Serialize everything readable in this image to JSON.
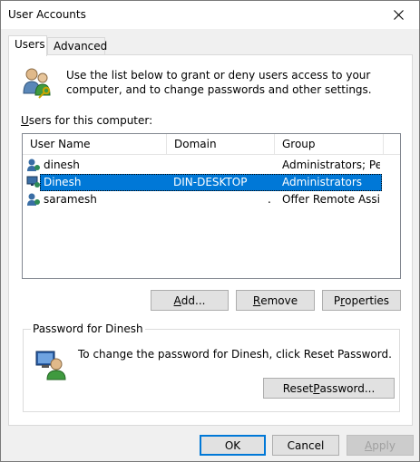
{
  "window": {
    "title": "User Accounts"
  },
  "icons": {
    "close": "close-icon",
    "users": "users-keys-icon",
    "user": "user-icon",
    "password": "password-user-icon"
  },
  "tabs": [
    {
      "label": "Users",
      "active": true
    },
    {
      "label": "Advanced",
      "active": false
    }
  ],
  "intro": {
    "text": "Use the list below to grant or deny users access to your computer, and to change passwords and other settings."
  },
  "users_section": {
    "label": "Users for this computer:"
  },
  "columns": [
    "User Name",
    "Domain",
    "Group"
  ],
  "rows": [
    {
      "user": "dinesh",
      "domain": "",
      "group": "Administrators; Pe...",
      "selected": false
    },
    {
      "user": "Dinesh",
      "domain": "DIN-DESKTOP",
      "group": "Administrators",
      "selected": true
    },
    {
      "user": "saramesh",
      "domain": ".",
      "group": "Offer Remote Assi...",
      "selected": false
    }
  ],
  "list_buttons": {
    "add": "Add...",
    "remove": "Remove",
    "properties": "Properties"
  },
  "password_group": {
    "title": "Password for Dinesh",
    "text": "To change the password for Dinesh, click Reset Password.",
    "reset_button": "Reset Password..."
  },
  "dialog_buttons": {
    "ok": "OK",
    "cancel": "Cancel",
    "apply": "Apply"
  },
  "colors": {
    "selection": "#0078d7",
    "window_bg": "#f0f0f0",
    "panel_bg": "#ffffff"
  }
}
